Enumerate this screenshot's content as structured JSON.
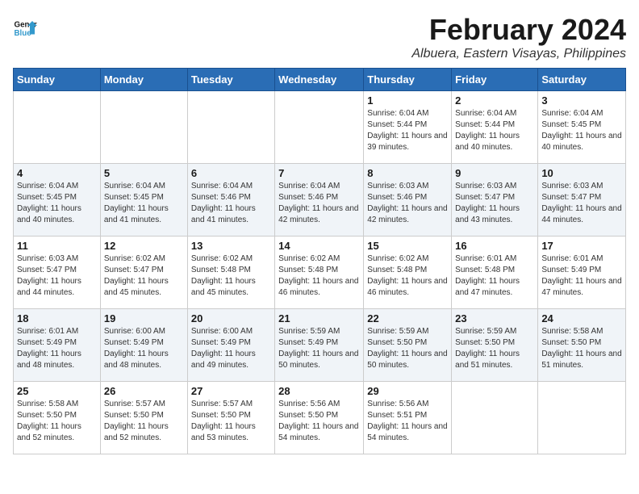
{
  "header": {
    "logo_line1": "General",
    "logo_line2": "Blue",
    "month": "February 2024",
    "location": "Albuera, Eastern Visayas, Philippines"
  },
  "weekdays": [
    "Sunday",
    "Monday",
    "Tuesday",
    "Wednesday",
    "Thursday",
    "Friday",
    "Saturday"
  ],
  "weeks": [
    [
      {
        "day": "",
        "sunrise": "",
        "sunset": "",
        "daylight": ""
      },
      {
        "day": "",
        "sunrise": "",
        "sunset": "",
        "daylight": ""
      },
      {
        "day": "",
        "sunrise": "",
        "sunset": "",
        "daylight": ""
      },
      {
        "day": "",
        "sunrise": "",
        "sunset": "",
        "daylight": ""
      },
      {
        "day": "1",
        "sunrise": "6:04 AM",
        "sunset": "5:44 PM",
        "daylight": "11 hours and 39 minutes."
      },
      {
        "day": "2",
        "sunrise": "6:04 AM",
        "sunset": "5:44 PM",
        "daylight": "11 hours and 40 minutes."
      },
      {
        "day": "3",
        "sunrise": "6:04 AM",
        "sunset": "5:45 PM",
        "daylight": "11 hours and 40 minutes."
      }
    ],
    [
      {
        "day": "4",
        "sunrise": "6:04 AM",
        "sunset": "5:45 PM",
        "daylight": "11 hours and 40 minutes."
      },
      {
        "day": "5",
        "sunrise": "6:04 AM",
        "sunset": "5:45 PM",
        "daylight": "11 hours and 41 minutes."
      },
      {
        "day": "6",
        "sunrise": "6:04 AM",
        "sunset": "5:46 PM",
        "daylight": "11 hours and 41 minutes."
      },
      {
        "day": "7",
        "sunrise": "6:04 AM",
        "sunset": "5:46 PM",
        "daylight": "11 hours and 42 minutes."
      },
      {
        "day": "8",
        "sunrise": "6:03 AM",
        "sunset": "5:46 PM",
        "daylight": "11 hours and 42 minutes."
      },
      {
        "day": "9",
        "sunrise": "6:03 AM",
        "sunset": "5:47 PM",
        "daylight": "11 hours and 43 minutes."
      },
      {
        "day": "10",
        "sunrise": "6:03 AM",
        "sunset": "5:47 PM",
        "daylight": "11 hours and 44 minutes."
      }
    ],
    [
      {
        "day": "11",
        "sunrise": "6:03 AM",
        "sunset": "5:47 PM",
        "daylight": "11 hours and 44 minutes."
      },
      {
        "day": "12",
        "sunrise": "6:02 AM",
        "sunset": "5:47 PM",
        "daylight": "11 hours and 45 minutes."
      },
      {
        "day": "13",
        "sunrise": "6:02 AM",
        "sunset": "5:48 PM",
        "daylight": "11 hours and 45 minutes."
      },
      {
        "day": "14",
        "sunrise": "6:02 AM",
        "sunset": "5:48 PM",
        "daylight": "11 hours and 46 minutes."
      },
      {
        "day": "15",
        "sunrise": "6:02 AM",
        "sunset": "5:48 PM",
        "daylight": "11 hours and 46 minutes."
      },
      {
        "day": "16",
        "sunrise": "6:01 AM",
        "sunset": "5:48 PM",
        "daylight": "11 hours and 47 minutes."
      },
      {
        "day": "17",
        "sunrise": "6:01 AM",
        "sunset": "5:49 PM",
        "daylight": "11 hours and 47 minutes."
      }
    ],
    [
      {
        "day": "18",
        "sunrise": "6:01 AM",
        "sunset": "5:49 PM",
        "daylight": "11 hours and 48 minutes."
      },
      {
        "day": "19",
        "sunrise": "6:00 AM",
        "sunset": "5:49 PM",
        "daylight": "11 hours and 48 minutes."
      },
      {
        "day": "20",
        "sunrise": "6:00 AM",
        "sunset": "5:49 PM",
        "daylight": "11 hours and 49 minutes."
      },
      {
        "day": "21",
        "sunrise": "5:59 AM",
        "sunset": "5:49 PM",
        "daylight": "11 hours and 50 minutes."
      },
      {
        "day": "22",
        "sunrise": "5:59 AM",
        "sunset": "5:50 PM",
        "daylight": "11 hours and 50 minutes."
      },
      {
        "day": "23",
        "sunrise": "5:59 AM",
        "sunset": "5:50 PM",
        "daylight": "11 hours and 51 minutes."
      },
      {
        "day": "24",
        "sunrise": "5:58 AM",
        "sunset": "5:50 PM",
        "daylight": "11 hours and 51 minutes."
      }
    ],
    [
      {
        "day": "25",
        "sunrise": "5:58 AM",
        "sunset": "5:50 PM",
        "daylight": "11 hours and 52 minutes."
      },
      {
        "day": "26",
        "sunrise": "5:57 AM",
        "sunset": "5:50 PM",
        "daylight": "11 hours and 52 minutes."
      },
      {
        "day": "27",
        "sunrise": "5:57 AM",
        "sunset": "5:50 PM",
        "daylight": "11 hours and 53 minutes."
      },
      {
        "day": "28",
        "sunrise": "5:56 AM",
        "sunset": "5:50 PM",
        "daylight": "11 hours and 54 minutes."
      },
      {
        "day": "29",
        "sunrise": "5:56 AM",
        "sunset": "5:51 PM",
        "daylight": "11 hours and 54 minutes."
      },
      {
        "day": "",
        "sunrise": "",
        "sunset": "",
        "daylight": ""
      },
      {
        "day": "",
        "sunrise": "",
        "sunset": "",
        "daylight": ""
      }
    ]
  ]
}
